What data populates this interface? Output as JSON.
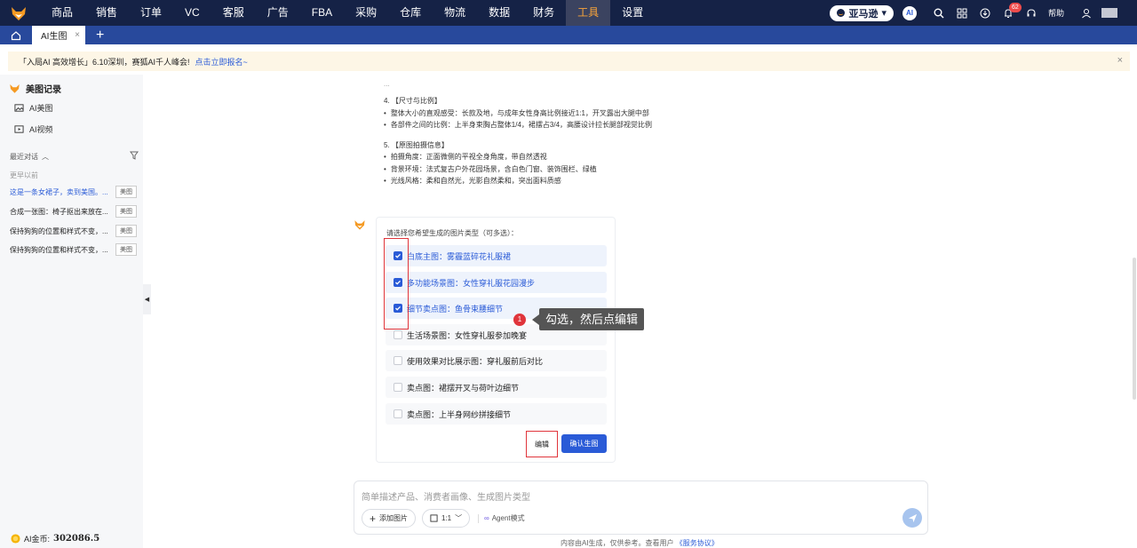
{
  "topnav": {
    "logo": "fox-logo",
    "items": [
      "商品",
      "销售",
      "订单",
      "VC",
      "客服",
      "广告",
      "FBA",
      "采购",
      "仓库",
      "物流",
      "数据",
      "财务",
      "工具",
      "设置"
    ],
    "active_index": 12,
    "marketplace": "亚马逊",
    "ai_label": "AI",
    "notification_count": "62",
    "help_label": "帮助"
  },
  "tabbar": {
    "tab_label": "AI生图",
    "close": "×",
    "add": "+"
  },
  "banner": {
    "text": "「入局AI 高效增长」6.10深圳，赛狐AI千人峰会!",
    "link": "点击立即报名~",
    "close": "×"
  },
  "sidebar": {
    "title": "美图记录",
    "links": [
      {
        "label": "AI美图",
        "icon": "image-icon"
      },
      {
        "label": "AI视频",
        "icon": "video-icon"
      }
    ],
    "recent_label": "最近对话",
    "earlier_label": "更早以前",
    "conversations": [
      {
        "title": "这是一条女裙子，卖到美国。...",
        "tag": "美图",
        "selected": true
      },
      {
        "title": "合成一张图：椅子抠出来放在...",
        "tag": "美图",
        "selected": false
      },
      {
        "title": "保持狗狗的位置和样式不变，...",
        "tag": "美图",
        "selected": false
      },
      {
        "title": "保持狗狗的位置和样式不变，...",
        "tag": "美图",
        "selected": false
      }
    ],
    "coins_label": "AI金币:",
    "coins_value": "302086.5"
  },
  "content": {
    "top_mark": "...",
    "sections": [
      {
        "heading": "4. 【尺寸与比例】",
        "bullets": [
          "整体大小的直观感受：长款及地，与成年女性身高比例接近1:1，开叉露出大腿中部",
          "各部件之间的比例：上半身束胸占整体1/4，裙摆占3/4，高腰设计拉长腿部视觉比例"
        ]
      },
      {
        "heading": "5. 【原图拍摄信息】",
        "bullets": [
          "拍摄角度：正面微侧的平视全身角度，带自然透视",
          "背景环境：法式复古户外花园场景，含白色门窗、装饰围栏、绿植",
          "光线风格：柔和自然光，光影自然柔和，突出面料质感"
        ]
      }
    ]
  },
  "selection_card": {
    "prompt": "请选择您希望生成的图片类型（可多选）：",
    "options": [
      {
        "label": "白底主图：雾霾蓝碎花礼服裙",
        "checked": true
      },
      {
        "label": "多功能场景图：女性穿礼服花园漫步",
        "checked": true
      },
      {
        "label": "细节卖点图：鱼骨束腰细节",
        "checked": true
      },
      {
        "label": "生活场景图：女性穿礼服参加晚宴",
        "checked": false
      },
      {
        "label": "使用效果对比展示图：穿礼服前后对比",
        "checked": false
      },
      {
        "label": "卖点图：裙摆开叉与荷叶边细节",
        "checked": false
      },
      {
        "label": "卖点图：上半身网纱拼接细节",
        "checked": false
      }
    ],
    "edit_label": "编辑",
    "confirm_label": "确认生图"
  },
  "annotation": {
    "number": "1",
    "text": "勾选，然后点编辑",
    "color": "#e0353b"
  },
  "input": {
    "placeholder": "简单描述产品、消费者画像、生成图片类型",
    "add_image_label": "添加图片",
    "ratio_label": "1:1",
    "agent_label": "Agent模式"
  },
  "footer": {
    "text": "内容由AI生成，仅供参考。查看用户",
    "link": "《服务协议》"
  },
  "colors": {
    "nav_bg": "#152246",
    "tab_bg": "#28499c",
    "accent": "#2a5bd7",
    "active_nav": "#f9a43a",
    "banner_bg": "#fdf6e6"
  }
}
